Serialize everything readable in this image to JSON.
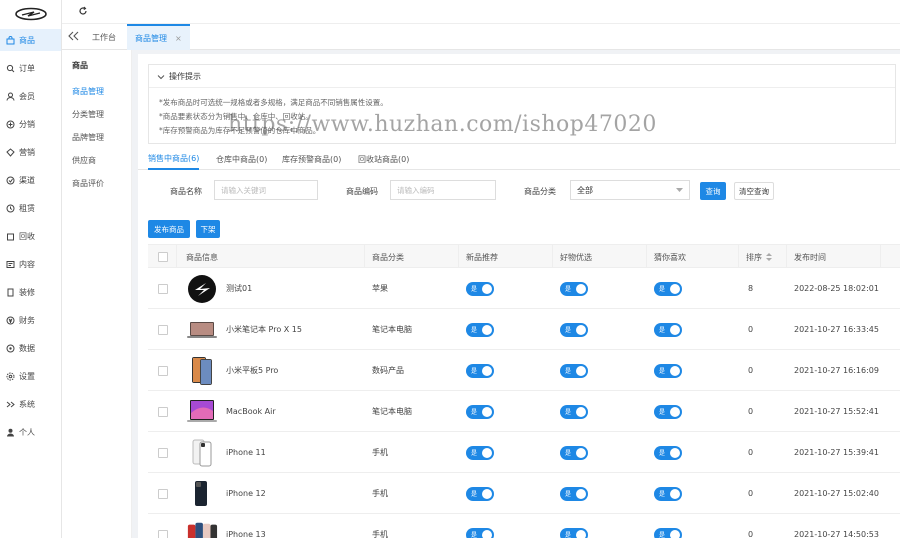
{
  "nav": {
    "items": [
      {
        "label": "商品",
        "icon": "bag-icon",
        "active": true
      },
      {
        "label": "订单",
        "icon": "search-doc-icon"
      },
      {
        "label": "会员",
        "icon": "user-icon"
      },
      {
        "label": "分销",
        "icon": "share-icon"
      },
      {
        "label": "营销",
        "icon": "gift-icon"
      },
      {
        "label": "渠道",
        "icon": "channel-icon"
      },
      {
        "label": "租赁",
        "icon": "lease-icon"
      },
      {
        "label": "回收",
        "icon": "recycle-icon"
      },
      {
        "label": "内容",
        "icon": "content-icon"
      },
      {
        "label": "装修",
        "icon": "decorate-icon"
      },
      {
        "label": "财务",
        "icon": "finance-icon"
      },
      {
        "label": "数据",
        "icon": "data-icon"
      },
      {
        "label": "设置",
        "icon": "settings-icon"
      },
      {
        "label": "系统",
        "icon": "system-icon"
      },
      {
        "label": "个人",
        "icon": "person-icon"
      }
    ]
  },
  "tabs": {
    "workbench": "工作台",
    "current": "商品管理",
    "close": "×"
  },
  "submenu": {
    "title": "商品",
    "items": [
      "商品管理",
      "分类管理",
      "品牌管理",
      "供应商",
      "商品评价"
    ]
  },
  "tips": {
    "title": "操作提示",
    "lines": [
      "*发布商品时可选统一规格或者多规格，满足商品不同销售属性设置。",
      "*商品要素状态分为销售中、仓库中、回收站。",
      "*库存预警商品为库存不足预警值的仓库中商品。"
    ]
  },
  "product_tabs": [
    "销售中商品(6)",
    "仓库中商品(0)",
    "库存预警商品(0)",
    "回收站商品(0)"
  ],
  "filters": {
    "name_label": "商品名称",
    "name_placeholder": "请输入关键词",
    "code_label": "商品编码",
    "code_placeholder": "请输入编码",
    "category_label": "商品分类",
    "category_value": "全部",
    "search_button": "查询",
    "reset_button": "清空查询"
  },
  "actions": {
    "publish": "发布商品",
    "offshelf": "下架"
  },
  "table": {
    "headers": [
      "商品信息",
      "商品分类",
      "新品推荐",
      "好物优选",
      "猜你喜欢",
      "排序",
      "发布时间"
    ],
    "switch_label": "是",
    "rows": [
      {
        "name": "测试01",
        "category": "苹果",
        "sort": "8",
        "time": "2022-08-25 18:02:01",
        "thumb": "logo"
      },
      {
        "name": "小米笔记本 Pro X 15",
        "category": "笔记本电脑",
        "sort": "0",
        "time": "2021-10-27 16:33:45",
        "thumb": "laptop"
      },
      {
        "name": "小米平板5 Pro",
        "category": "数码产品",
        "sort": "0",
        "time": "2021-10-27 16:16:09",
        "thumb": "tablet"
      },
      {
        "name": "MacBook Air",
        "category": "笔记本电脑",
        "sort": "0",
        "time": "2021-10-27 15:52:41",
        "thumb": "macbook"
      },
      {
        "name": "iPhone 11",
        "category": "手机",
        "sort": "0",
        "time": "2021-10-27 15:39:41",
        "thumb": "phone11"
      },
      {
        "name": "iPhone 12",
        "category": "手机",
        "sort": "0",
        "time": "2021-10-27 15:02:40",
        "thumb": "phone12"
      },
      {
        "name": "iPhone 13",
        "category": "手机",
        "sort": "0",
        "time": "2021-10-27 14:50:53",
        "thumb": "phone13"
      }
    ]
  },
  "watermark": "https://www.huzhan.com/ishop47020",
  "colors": {
    "accent": "#1e88e5"
  }
}
